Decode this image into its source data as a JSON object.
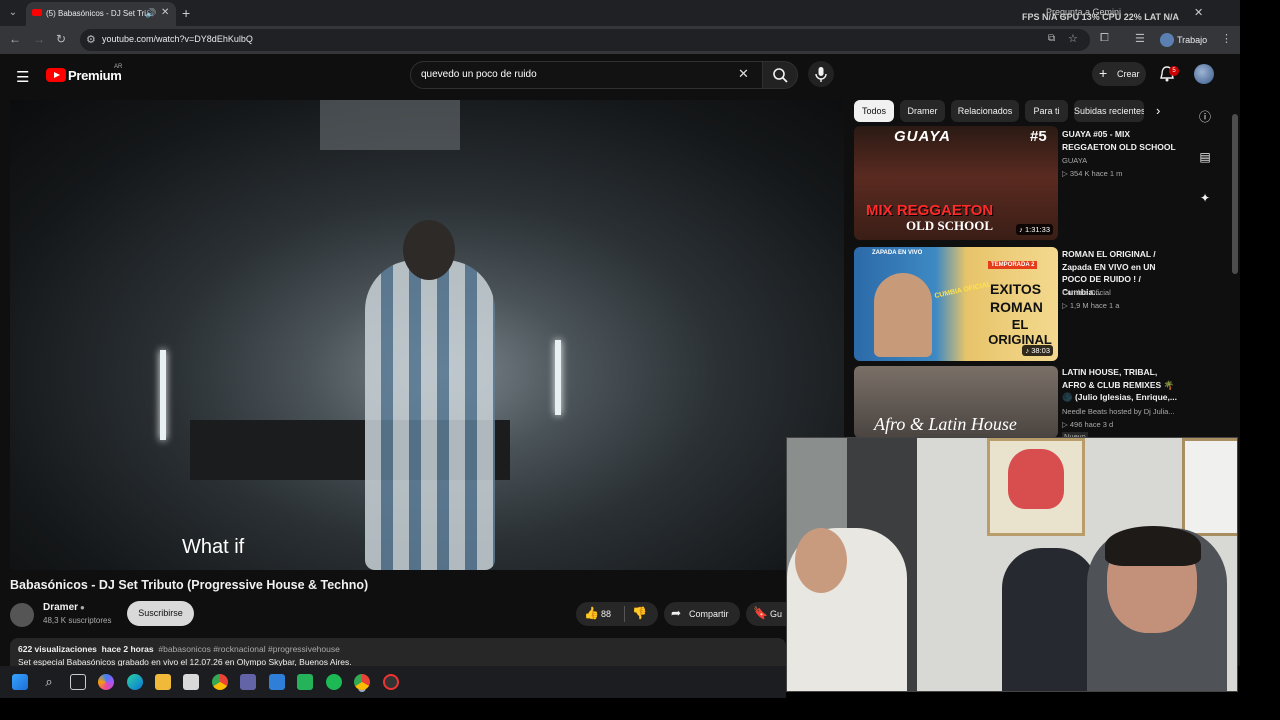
{
  "browser": {
    "tab_title": "(5) Babasónicos - DJ Set Tri",
    "url": "youtube.com/watch?v=DY8dEhKulbQ",
    "gemini_label": "Pregunta a Gemini",
    "perf_overlay": "FPS  N/A    GPU  13%    CPU  22%    LAT  N/A",
    "profile_label": "Trabajo"
  },
  "youtube": {
    "logo_text": "Premium",
    "country_code": "AR",
    "search_query": "quevedo un poco de ruido",
    "create_label": "Crear",
    "notif_count": "5"
  },
  "video": {
    "subtitle": "What if",
    "title": "Babasónicos - DJ Set Tributo (Progressive House & Techno)",
    "channel_name": "Dramer",
    "channel_subs": "48,3 K suscriptores",
    "subscribe_label": "Suscribirse",
    "likes": "88",
    "share_label": "Compartir",
    "save_label": "Gu",
    "views": "622 visualizaciones",
    "age": "hace 2 horas",
    "tags": "#babasonicos #rocknacional #progressivehouse",
    "description": "Set especial Babasónicos grabado en vivo el 12.07.26 en Olympo Skybar, Buenos Aires."
  },
  "chips": [
    "Todos",
    "Dramer",
    "Relacionados",
    "Para ti",
    "Subidas recientes"
  ],
  "recommendations": [
    {
      "title": "GUAYA #05 - MIX REGGAETON OLD SCHOOL",
      "channel": "GUAYA",
      "meta": "▷ 354 K   hace 1 m",
      "duration": "♪ 1:31:33",
      "thumb_top": "GUAYA",
      "thumb_num": "#5",
      "thumb_line1": "MIX REGGAETON",
      "thumb_line2": "OLD SCHOOL"
    },
    {
      "title": "ROMAN EL ORIGINAL / Zapada EN VIVO en UN POCO DE RUIDO ! / Cumbia...",
      "channel": "Cumbia Oficial",
      "meta": "▷ 1,9 M   hace 1 a",
      "duration": "♪ 38:03",
      "thumb_tag": "ZAPADA EN VIVO",
      "thumb_season": "TEMPORADA 2",
      "thumb_brand": "CUMBIA OFICIAL",
      "thumb_line1": "EXITOS",
      "thumb_line2": "ROMAN",
      "thumb_line3": "EL ORIGINAL"
    },
    {
      "title": "LATIN HOUSE, TRIBAL, AFRO & CLUB REMIXES 🌴 🌑 (Julio Iglesias, Enrique,...",
      "channel": "Needle Beats hosted by Dj Julia...",
      "meta": "▷ 496   hace 3 d",
      "extra": "Nuevo",
      "thumb_line1": "Afro & Latin House"
    }
  ],
  "colors": {
    "youtube_red": "#ff0000",
    "page_bg": "#0f0f0f",
    "chip_bg": "#272727"
  }
}
